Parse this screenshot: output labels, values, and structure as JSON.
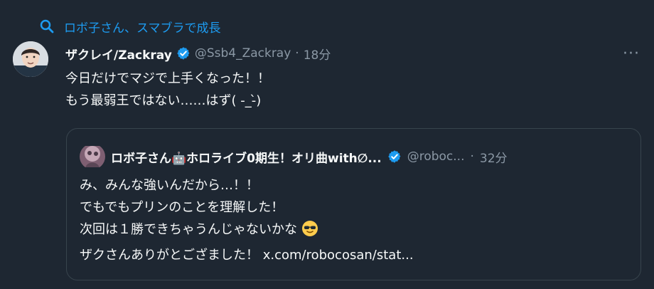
{
  "context": {
    "search_icon": "search-icon",
    "text": "ロボ子さん、スマブラで成長"
  },
  "tweet": {
    "author_name": "ザクレイ/Zackray",
    "handle": "@Ssb4_Zackray",
    "separator": "·",
    "time": "18分",
    "more_label": "···",
    "lines": [
      "今日だけでマジで上手くなった！！",
      "もう最弱王ではない……はず( -_-̀)"
    ]
  },
  "quote": {
    "author_name": "ロボ子さん🤖ホロライブ0期生！オリ曲with∅...",
    "handle": "@roboc...",
    "separator": "·",
    "time": "32分",
    "lines": [
      "み、みんな強いんだから…！！",
      "でもでもプリンのことを理解した！",
      "次回は１勝できちゃうんじゃないかな",
      "ザクさんありがとござました！ x.com/robocosan/stat..."
    ]
  },
  "colors": {
    "background": "#1e2732",
    "text": "#f7f9f9",
    "muted": "#8b98a5",
    "accent": "#1d9bf0",
    "border": "#38444d"
  }
}
